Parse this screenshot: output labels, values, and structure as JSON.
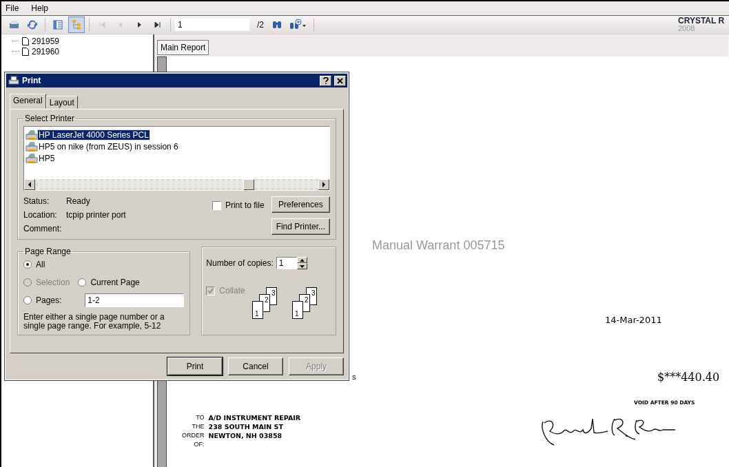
{
  "menu": [
    {
      "label": "File"
    },
    {
      "label": "Help"
    }
  ],
  "toolbar": {
    "buttons": [
      {
        "kind": "print",
        "disabled": false,
        "pressed": false
      },
      {
        "kind": "refresh",
        "disabled": false,
        "pressed": false
      },
      {
        "kind": "panel",
        "disabled": false,
        "pressed": false
      },
      {
        "kind": "tree",
        "disabled": false,
        "pressed": true
      },
      {
        "kind": "first",
        "disabled": true,
        "pressed": false
      },
      {
        "kind": "prev",
        "disabled": true,
        "pressed": false
      },
      {
        "kind": "next",
        "disabled": false,
        "pressed": false
      },
      {
        "kind": "last",
        "disabled": false,
        "pressed": false
      }
    ],
    "page_value": "1",
    "page_count": "/2",
    "brand": "CRYSTAL R",
    "brand_year": "2008"
  },
  "tree": {
    "items": [
      {
        "label": "291959"
      },
      {
        "label": "291960"
      }
    ]
  },
  "report_tabs": [
    {
      "label": "Main Report",
      "selected": true
    }
  ],
  "report": {
    "title": "Manual Warrant 005715",
    "fragment": "s",
    "date": "14-Mar-2011",
    "amount": "$***440.40",
    "void_note": "VOID AFTER 90 DAYS",
    "payee_labels": [
      "TO",
      "THE",
      "ORDER",
      "OF:"
    ],
    "payee_lines": [
      "A/D INSTRUMENT REPAIR",
      "238 SOUTH MAIN ST",
      "NEWTON, NH  03858"
    ]
  },
  "dialog": {
    "title": "Print",
    "tabs": [
      {
        "label": "General",
        "selected": true
      },
      {
        "label": "Layout",
        "selected": false
      }
    ],
    "select_printer": {
      "legend": "Select Printer",
      "printers": [
        {
          "name": "HP LaserJet 4000 Series PCL",
          "selected": true
        },
        {
          "name": "HP5 on nike (from ZEUS) in session 6",
          "selected": false
        },
        {
          "name": "HP5",
          "selected": false
        }
      ],
      "info": [
        {
          "label": "Status:",
          "value": "Ready"
        },
        {
          "label": "Location:",
          "value": "tcpip printer port"
        },
        {
          "label": "Comment:"
        }
      ],
      "print_to_file": {
        "label": "Print to file",
        "checked": false
      },
      "preferences": "Preferences",
      "find_printer": "Find Printer..."
    },
    "page_range": {
      "legend": "Page Range",
      "options": [
        {
          "label": "All",
          "selected": true,
          "disabled": false
        },
        {
          "label": "Selection",
          "selected": false,
          "disabled": true
        },
        {
          "label": "Current Page",
          "selected": false,
          "disabled": false
        },
        {
          "label": "Pages:",
          "selected": false,
          "disabled": false
        }
      ],
      "pages_value": "1-2",
      "hint": "Enter either a single page number or a single page range.  For example, 5-12"
    },
    "copies": {
      "label": "Number of copies:",
      "value": "1",
      "collate": {
        "label": "Collate",
        "checked": true,
        "disabled": true,
        "page_stacks": [
          [
            "1",
            "2",
            "3"
          ],
          [
            "1",
            "2",
            "3"
          ]
        ]
      }
    },
    "buttons": [
      {
        "label": "Print",
        "disabled": false,
        "default": true
      },
      {
        "label": "Cancel",
        "disabled": false,
        "default": false
      },
      {
        "label": "Apply",
        "disabled": true,
        "default": false
      }
    ]
  }
}
